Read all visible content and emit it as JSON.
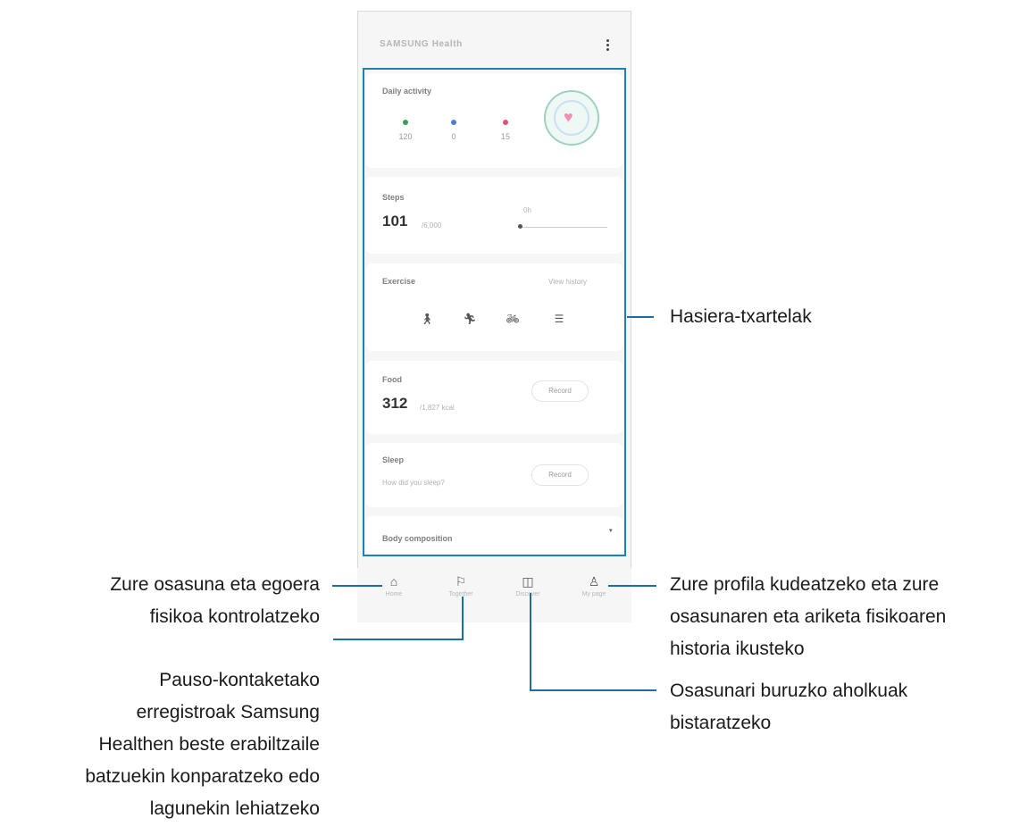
{
  "app": {
    "title": "SAMSUNG Health"
  },
  "cards": {
    "daily_activity": {
      "label": "Daily activity",
      "metrics": [
        "120",
        "0",
        "15"
      ]
    },
    "steps": {
      "label": "Steps",
      "value": "101",
      "goal": "/6,000",
      "chart_label": "0h"
    },
    "exercise": {
      "label": "Exercise",
      "link": "View history"
    },
    "food": {
      "label": "Food",
      "value": "312",
      "goal": "/1,827 kcal",
      "button": "Record"
    },
    "sleep": {
      "label": "Sleep",
      "question": "How did you sleep?",
      "button": "Record"
    },
    "body": {
      "label": "Body composition"
    }
  },
  "nav": [
    {
      "label": "Home",
      "icon": "home-icon"
    },
    {
      "label": "Together",
      "icon": "flag-icon"
    },
    {
      "label": "Discover",
      "icon": "discover-icon"
    },
    {
      "label": "My page",
      "icon": "person-icon"
    }
  ],
  "callouts": {
    "home_cards": "Hasiera-txartelak",
    "home_tab": [
      "Zure osasuna eta egoera",
      "fisikoa kontrolatzeko"
    ],
    "together_tab": [
      "Pauso-kontaketako",
      "erregistroak Samsung",
      "Healthen beste erabiltzaile",
      "batzuekin konparatzeko edo",
      "lagunekin lehiatzeko"
    ],
    "my_page_tab": [
      "Zure profila kudeatzeko eta zure",
      "osasunaren eta ariketa fisikoaren",
      "historia ikusteko"
    ],
    "discover_tab": [
      "Osasunari buruzko aholkuak",
      "bistaratzeko"
    ]
  },
  "colors": {
    "callout_line": "#1a6fa6",
    "highlight_border": "#1f7fba",
    "activity_green": "#3a9d5b",
    "activity_blue": "#4a7fd6",
    "activity_red": "#e0507a"
  }
}
